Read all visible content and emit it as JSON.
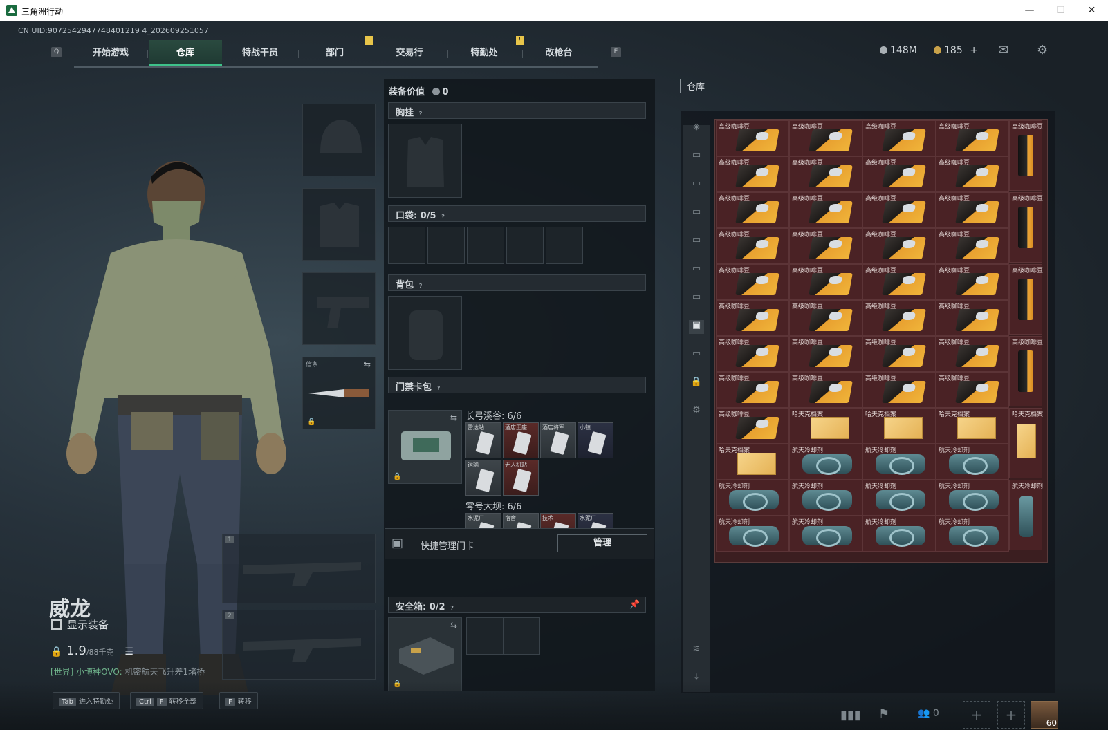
{
  "window": {
    "title": "三角洲行动",
    "min": "—",
    "max": "☐",
    "close": "✕"
  },
  "uid": "CN UID:9072542947748401219 4_202609251057",
  "nav": {
    "key_left": "Q",
    "key_right": "E",
    "tabs": [
      "开始游戏",
      "仓库",
      "特战干员",
      "部门",
      "交易行",
      "特勤处",
      "改枪台"
    ],
    "active": "仓库",
    "marker": "!"
  },
  "currency": {
    "silver": "148M",
    "gold": "185",
    "gold_add": "+"
  },
  "character": {
    "name": "威龙",
    "show_gear_label": "显示装备",
    "weight": "1.9",
    "weight_max": "/88千克"
  },
  "chat": {
    "channel": "[世界] 小博种OVO:",
    "message": "机密航天飞升差1堵桥"
  },
  "hints": [
    {
      "keys": [
        "Tab"
      ],
      "label": "进入特勤处"
    },
    {
      "keys": [
        "Ctrl",
        "F"
      ],
      "label": "转移全部"
    },
    {
      "keys": [
        "F"
      ],
      "label": "转移"
    }
  ],
  "gear_slots": {
    "melee_label": "信条",
    "weapon1": "1",
    "weapon2": "2"
  },
  "gear_panel": {
    "value_label": "装备价值",
    "value": "0",
    "chest_label": "胸挂",
    "pocket_label": "口袋:",
    "pocket_count": "0/5",
    "backpack_label": "背包",
    "keycard_label": "门禁卡包",
    "group1_label": "长弓溪谷: 6/6",
    "group1_cards": [
      {
        "label": "雷达站",
        "color": "grey"
      },
      {
        "label": "酒店王座",
        "color": "red"
      },
      {
        "label": "酒店将军",
        "color": "grey"
      },
      {
        "label": "小镇",
        "color": "navy"
      },
      {
        "label": "运输",
        "color": "grey"
      },
      {
        "label": "无人机站",
        "color": "red"
      }
    ],
    "group2_label": "零号大坝: 6/6",
    "group2_cards": [
      {
        "label": "水泥厂",
        "color": "grey"
      },
      {
        "label": "宿舍",
        "color": "grey"
      },
      {
        "label": "技术",
        "color": "red"
      },
      {
        "label": "水泥厂",
        "color": "navy"
      }
    ],
    "quick_manage_label": "快捷管理门卡",
    "manage_button": "管理",
    "safebox_label": "安全箱:",
    "safebox_count": "0/2"
  },
  "warehouse": {
    "title": "仓库",
    "items": {
      "coffee": "高级咖啡豆",
      "file": "哈夫克档案",
      "coolant": "航天冷却剂"
    },
    "side_tabs": [
      "all",
      "helmet",
      "armor",
      "ammo1",
      "ammo2",
      "ammo3",
      "ammo4",
      "medical",
      "supplies",
      "collectibles",
      "lock",
      "settings"
    ],
    "bottom_tabs": [
      "layers",
      "sort"
    ]
  },
  "bottom_right": {
    "party_count": "0",
    "level": "60"
  },
  "colors": {
    "accent": "#3ec28a",
    "item_bg": "#4a2225"
  }
}
